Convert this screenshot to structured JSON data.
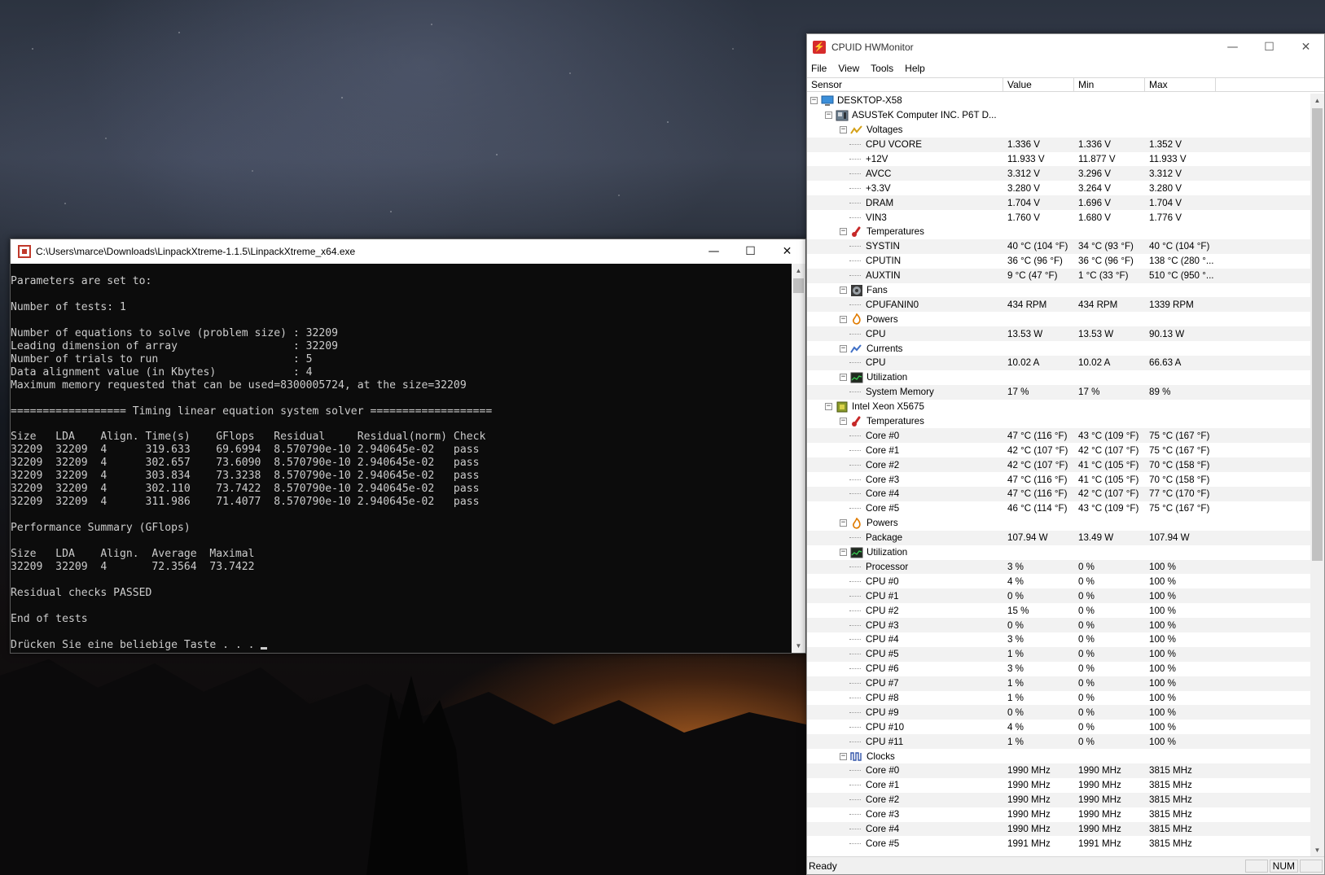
{
  "console": {
    "title": "C:\\Users\\marce\\Downloads\\LinpackXtreme-1.1.5\\LinpackXtreme_x64.exe",
    "lines": [
      "Parameters are set to:",
      "",
      "Number of tests: 1",
      "",
      "Number of equations to solve (problem size) : 32209",
      "Leading dimension of array                  : 32209",
      "Number of trials to run                     : 5",
      "Data alignment value (in Kbytes)            : 4",
      "Maximum memory requested that can be used=8300005724, at the size=32209",
      "",
      "================== Timing linear equation system solver ===================",
      "",
      "Size   LDA    Align. Time(s)    GFlops   Residual     Residual(norm) Check",
      "32209  32209  4      319.633    69.6994  8.570790e-10 2.940645e-02   pass",
      "32209  32209  4      302.657    73.6090  8.570790e-10 2.940645e-02   pass",
      "32209  32209  4      303.834    73.3238  8.570790e-10 2.940645e-02   pass",
      "32209  32209  4      302.110    73.7422  8.570790e-10 2.940645e-02   pass",
      "32209  32209  4      311.986    71.4077  8.570790e-10 2.940645e-02   pass",
      "",
      "Performance Summary (GFlops)",
      "",
      "Size   LDA    Align.  Average  Maximal",
      "32209  32209  4       72.3564  73.7422",
      "",
      "Residual checks PASSED",
      "",
      "End of tests",
      "",
      "Drücken Sie eine beliebige Taste . . . "
    ]
  },
  "hwmonitor": {
    "title": "CPUID HWMonitor",
    "menu": [
      "File",
      "View",
      "Tools",
      "Help"
    ],
    "columns": {
      "sensor": "Sensor",
      "value": "Value",
      "min": "Min",
      "max": "Max"
    },
    "status": {
      "text": "Ready",
      "num": "NUM"
    },
    "rows": [
      {
        "level": 0,
        "kind": "node",
        "icon": "computer-icon",
        "label": "DESKTOP-X58"
      },
      {
        "level": 1,
        "kind": "node",
        "icon": "motherboard-icon",
        "label": "ASUSTeK Computer INC. P6T D..."
      },
      {
        "level": 2,
        "kind": "group",
        "icon": "voltage-icon",
        "label": "Voltages"
      },
      {
        "level": 3,
        "kind": "sensor",
        "label": "CPU VCORE",
        "value": "1.336 V",
        "min": "1.336 V",
        "max": "1.352 V"
      },
      {
        "level": 3,
        "kind": "sensor",
        "label": "+12V",
        "value": "11.933 V",
        "min": "11.877 V",
        "max": "11.933 V"
      },
      {
        "level": 3,
        "kind": "sensor",
        "label": "AVCC",
        "value": "3.312 V",
        "min": "3.296 V",
        "max": "3.312 V"
      },
      {
        "level": 3,
        "kind": "sensor",
        "label": "+3.3V",
        "value": "3.280 V",
        "min": "3.264 V",
        "max": "3.280 V"
      },
      {
        "level": 3,
        "kind": "sensor",
        "label": "DRAM",
        "value": "1.704 V",
        "min": "1.696 V",
        "max": "1.704 V"
      },
      {
        "level": 3,
        "kind": "sensor",
        "label": "VIN3",
        "value": "1.760 V",
        "min": "1.680 V",
        "max": "1.776 V"
      },
      {
        "level": 2,
        "kind": "group",
        "icon": "thermometer-icon",
        "label": "Temperatures"
      },
      {
        "level": 3,
        "kind": "sensor",
        "label": "SYSTIN",
        "value": "40 °C  (104 °F)",
        "min": "34 °C  (93 °F)",
        "max": "40 °C  (104 °F)"
      },
      {
        "level": 3,
        "kind": "sensor",
        "label": "CPUTIN",
        "value": "36 °C  (96 °F)",
        "min": "36 °C  (96 °F)",
        "max": "138 °C  (280 °..."
      },
      {
        "level": 3,
        "kind": "sensor",
        "label": "AUXTIN",
        "value": "9 °C  (47 °F)",
        "min": "1 °C  (33 °F)",
        "max": "510 °C  (950 °..."
      },
      {
        "level": 2,
        "kind": "group",
        "icon": "fan-icon",
        "label": "Fans"
      },
      {
        "level": 3,
        "kind": "sensor",
        "label": "CPUFANIN0",
        "value": "434 RPM",
        "min": "434 RPM",
        "max": "1339 RPM"
      },
      {
        "level": 2,
        "kind": "group",
        "icon": "power-icon",
        "label": "Powers"
      },
      {
        "level": 3,
        "kind": "sensor",
        "label": "CPU",
        "value": "13.53 W",
        "min": "13.53 W",
        "max": "90.13 W"
      },
      {
        "level": 2,
        "kind": "group",
        "icon": "current-icon",
        "label": "Currents"
      },
      {
        "level": 3,
        "kind": "sensor",
        "label": "CPU",
        "value": "10.02 A",
        "min": "10.02 A",
        "max": "66.63 A"
      },
      {
        "level": 2,
        "kind": "group",
        "icon": "utilization-icon",
        "label": "Utilization"
      },
      {
        "level": 3,
        "kind": "sensor",
        "label": "System Memory",
        "value": "17 %",
        "min": "17 %",
        "max": "89 %"
      },
      {
        "level": 1,
        "kind": "node",
        "icon": "cpu-chip-icon",
        "label": "Intel Xeon X5675"
      },
      {
        "level": 2,
        "kind": "group",
        "icon": "thermometer-icon",
        "label": "Temperatures"
      },
      {
        "level": 3,
        "kind": "sensor",
        "label": "Core #0",
        "value": "47 °C  (116 °F)",
        "min": "43 °C  (109 °F)",
        "max": "75 °C  (167 °F)"
      },
      {
        "level": 3,
        "kind": "sensor",
        "label": "Core #1",
        "value": "42 °C  (107 °F)",
        "min": "42 °C  (107 °F)",
        "max": "75 °C  (167 °F)"
      },
      {
        "level": 3,
        "kind": "sensor",
        "label": "Core #2",
        "value": "42 °C  (107 °F)",
        "min": "41 °C  (105 °F)",
        "max": "70 °C  (158 °F)"
      },
      {
        "level": 3,
        "kind": "sensor",
        "label": "Core #3",
        "value": "47 °C  (116 °F)",
        "min": "41 °C  (105 °F)",
        "max": "70 °C  (158 °F)"
      },
      {
        "level": 3,
        "kind": "sensor",
        "label": "Core #4",
        "value": "47 °C  (116 °F)",
        "min": "42 °C  (107 °F)",
        "max": "77 °C  (170 °F)"
      },
      {
        "level": 3,
        "kind": "sensor",
        "label": "Core #5",
        "value": "46 °C  (114 °F)",
        "min": "43 °C  (109 °F)",
        "max": "75 °C  (167 °F)"
      },
      {
        "level": 2,
        "kind": "group",
        "icon": "power-icon",
        "label": "Powers"
      },
      {
        "level": 3,
        "kind": "sensor",
        "label": "Package",
        "value": "107.94 W",
        "min": "13.49 W",
        "max": "107.94 W"
      },
      {
        "level": 2,
        "kind": "group",
        "icon": "utilization-icon",
        "label": "Utilization"
      },
      {
        "level": 3,
        "kind": "sensor",
        "label": "Processor",
        "value": "3 %",
        "min": "0 %",
        "max": "100 %"
      },
      {
        "level": 3,
        "kind": "sensor",
        "label": "CPU #0",
        "value": "4 %",
        "min": "0 %",
        "max": "100 %"
      },
      {
        "level": 3,
        "kind": "sensor",
        "label": "CPU #1",
        "value": "0 %",
        "min": "0 %",
        "max": "100 %"
      },
      {
        "level": 3,
        "kind": "sensor",
        "label": "CPU #2",
        "value": "15 %",
        "min": "0 %",
        "max": "100 %"
      },
      {
        "level": 3,
        "kind": "sensor",
        "label": "CPU #3",
        "value": "0 %",
        "min": "0 %",
        "max": "100 %"
      },
      {
        "level": 3,
        "kind": "sensor",
        "label": "CPU #4",
        "value": "3 %",
        "min": "0 %",
        "max": "100 %"
      },
      {
        "level": 3,
        "kind": "sensor",
        "label": "CPU #5",
        "value": "1 %",
        "min": "0 %",
        "max": "100 %"
      },
      {
        "level": 3,
        "kind": "sensor",
        "label": "CPU #6",
        "value": "3 %",
        "min": "0 %",
        "max": "100 %"
      },
      {
        "level": 3,
        "kind": "sensor",
        "label": "CPU #7",
        "value": "1 %",
        "min": "0 %",
        "max": "100 %"
      },
      {
        "level": 3,
        "kind": "sensor",
        "label": "CPU #8",
        "value": "1 %",
        "min": "0 %",
        "max": "100 %"
      },
      {
        "level": 3,
        "kind": "sensor",
        "label": "CPU #9",
        "value": "0 %",
        "min": "0 %",
        "max": "100 %"
      },
      {
        "level": 3,
        "kind": "sensor",
        "label": "CPU #10",
        "value": "4 %",
        "min": "0 %",
        "max": "100 %"
      },
      {
        "level": 3,
        "kind": "sensor",
        "label": "CPU #11",
        "value": "1 %",
        "min": "0 %",
        "max": "100 %"
      },
      {
        "level": 2,
        "kind": "group",
        "icon": "clock-icon",
        "label": "Clocks"
      },
      {
        "level": 3,
        "kind": "sensor",
        "label": "Core #0",
        "value": "1990 MHz",
        "min": "1990 MHz",
        "max": "3815 MHz"
      },
      {
        "level": 3,
        "kind": "sensor",
        "label": "Core #1",
        "value": "1990 MHz",
        "min": "1990 MHz",
        "max": "3815 MHz"
      },
      {
        "level": 3,
        "kind": "sensor",
        "label": "Core #2",
        "value": "1990 MHz",
        "min": "1990 MHz",
        "max": "3815 MHz"
      },
      {
        "level": 3,
        "kind": "sensor",
        "label": "Core #3",
        "value": "1990 MHz",
        "min": "1990 MHz",
        "max": "3815 MHz"
      },
      {
        "level": 3,
        "kind": "sensor",
        "label": "Core #4",
        "value": "1990 MHz",
        "min": "1990 MHz",
        "max": "3815 MHz"
      },
      {
        "level": 3,
        "kind": "sensor",
        "label": "Core #5",
        "value": "1991 MHz",
        "min": "1991 MHz",
        "max": "3815 MHz"
      }
    ]
  },
  "colors": {
    "console_bg": "#0c0c0c",
    "console_text": "#cccccc",
    "hwm_accent": "#d62b2b"
  }
}
